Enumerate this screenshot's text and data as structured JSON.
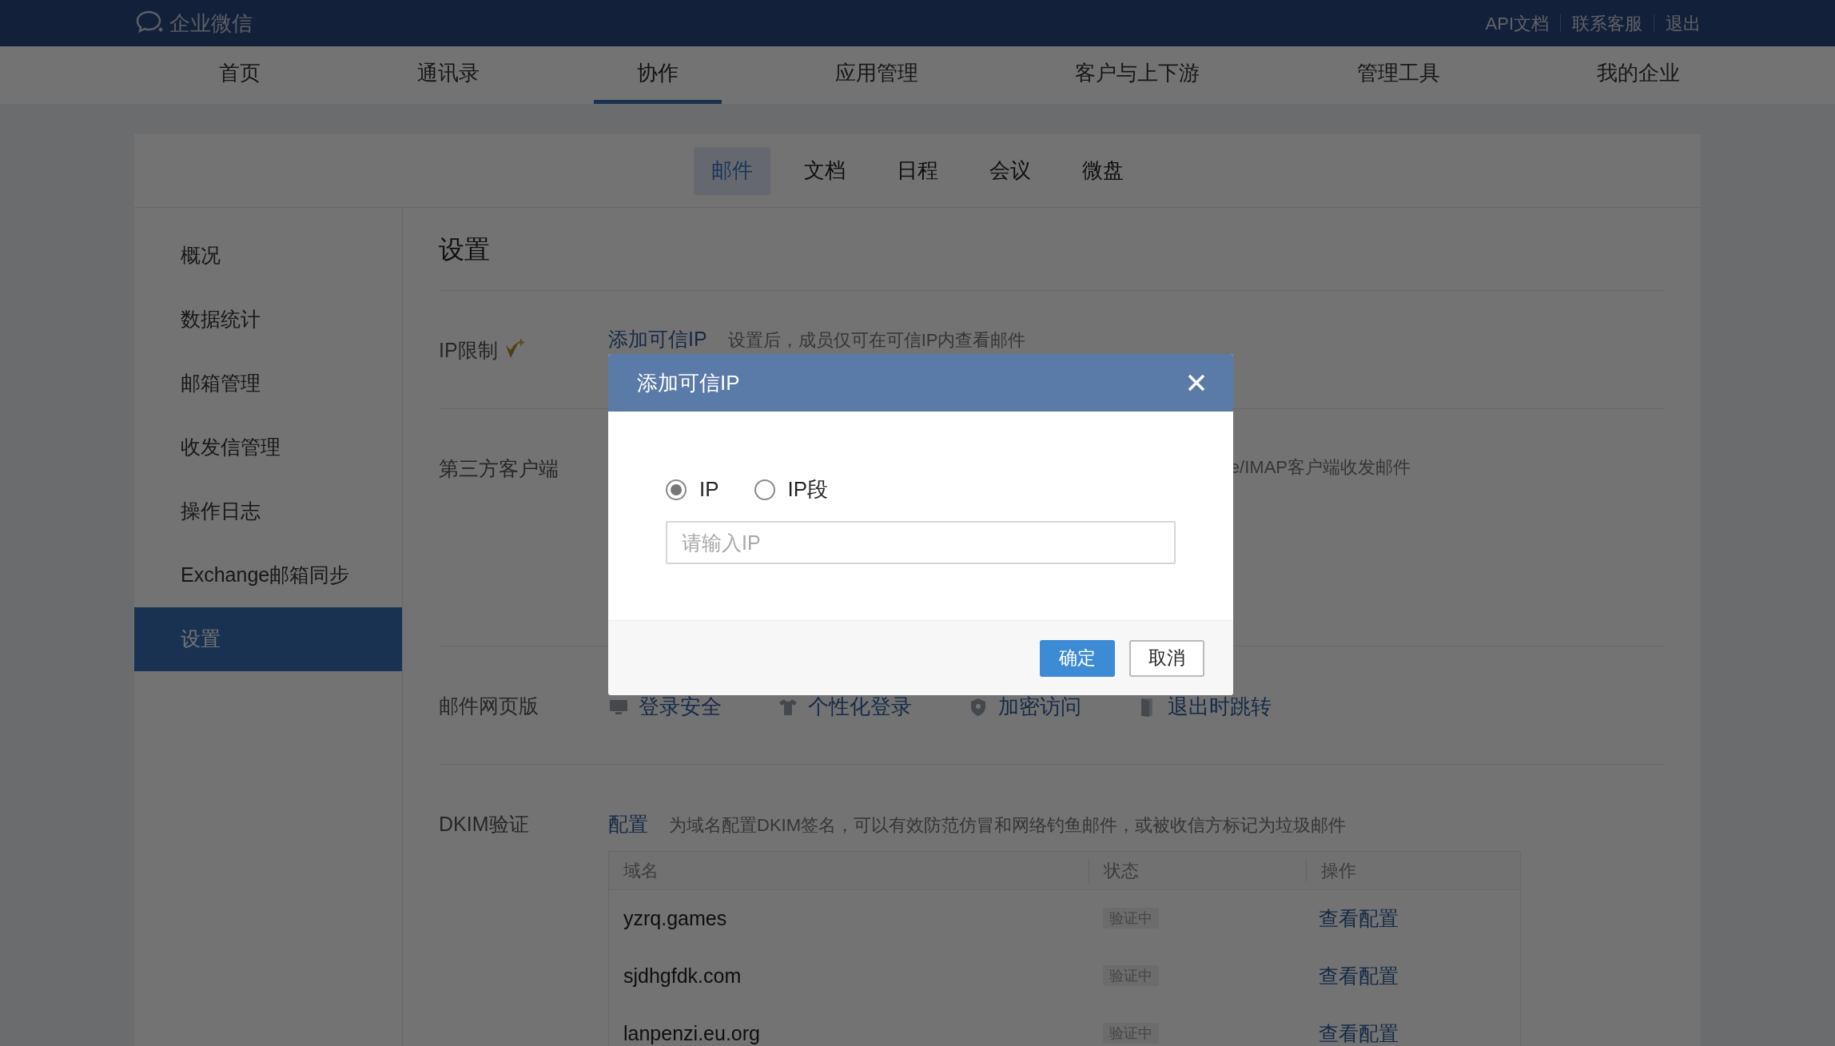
{
  "top_bar": {
    "logo": "企业微信",
    "links": [
      "API文档",
      "联系客服",
      "退出"
    ]
  },
  "nav": [
    {
      "label": "首页",
      "selected": false
    },
    {
      "label": "通讯录",
      "selected": false
    },
    {
      "label": "协作",
      "selected": true
    },
    {
      "label": "应用管理",
      "selected": false
    },
    {
      "label": "客户与上下游",
      "selected": false
    },
    {
      "label": "管理工具",
      "selected": false
    },
    {
      "label": "我的企业",
      "selected": false
    }
  ],
  "sub_tabs": [
    {
      "label": "邮件",
      "selected": true
    },
    {
      "label": "文档",
      "selected": false
    },
    {
      "label": "日程",
      "selected": false
    },
    {
      "label": "会议",
      "selected": false
    },
    {
      "label": "微盘",
      "selected": false
    }
  ],
  "sidebar": [
    {
      "label": "概况",
      "selected": false
    },
    {
      "label": "数据统计",
      "selected": false
    },
    {
      "label": "邮箱管理",
      "selected": false
    },
    {
      "label": "收发信管理",
      "selected": false
    },
    {
      "label": "操作日志",
      "selected": false
    },
    {
      "label": "Exchange邮箱同步",
      "selected": false
    },
    {
      "label": "设置",
      "selected": true
    }
  ],
  "page_title": "设置",
  "settings": [
    {
      "kind": "ip",
      "label": "IP限制",
      "link": "添加可信IP",
      "note": "设置后，成员仅可在可信IP内查看邮件"
    },
    {
      "kind": "text",
      "label": "第三方客户端",
      "note": "e/IMAP客户端收发邮件"
    },
    {
      "kind": "links",
      "label": "邮件网页版",
      "links": [
        {
          "label": "登录安全"
        },
        {
          "label": "个性化登录"
        },
        {
          "label": "加密访问"
        },
        {
          "label": "退出时跳转"
        }
      ]
    },
    {
      "kind": "dkim",
      "label": "DKIM验证",
      "link": "配置",
      "note": "为域名配置DKIM签名，可以有效防范仿冒和网络钓鱼邮件，或被收信方标记为垃圾邮件",
      "table": {
        "columns": [
          "域名",
          "状态",
          "操作"
        ],
        "rows": [
          {
            "domain": "yzrq.games",
            "status": "验证中",
            "action": "查看配置"
          },
          {
            "domain": "sjdhgfdk.com",
            "status": "验证中",
            "action": "查看配置"
          },
          {
            "domain": "lanpenzi.eu.org",
            "status": "验证中",
            "action": "查看配置"
          }
        ]
      }
    }
  ],
  "dialog": {
    "title": "添加可信IP",
    "options": [
      {
        "label": "IP",
        "selected": true
      },
      {
        "label": "IP段",
        "selected": false
      }
    ],
    "input": {
      "placeholder": "请输入IP"
    },
    "buttons": [
      {
        "label": "确定",
        "kind": "primary"
      },
      {
        "label": "取消",
        "kind": "default"
      }
    ]
  }
}
